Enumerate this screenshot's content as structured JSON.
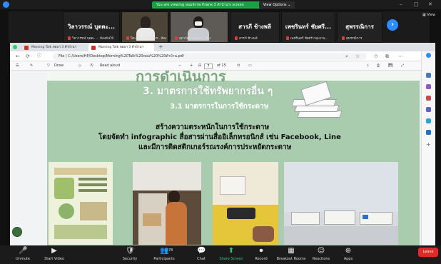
{
  "zoom": {
    "share_banner": "You are viewing หอมจักรพ Hrane 3 ตำบ้าน's screen",
    "view_options": "View Options ⌄",
    "view_label": "▦ View",
    "leave": "Leave"
  },
  "gallery": [
    {
      "name": "วิลาวรรณ์ บุตตะ...",
      "sub": "วิลาวรรณ์ บุตตะ ... ห้องต้นไม้"
    },
    {
      "name": "",
      "sub": "ปิยะวรร.นาวาสจิตร...ห้อง"
    },
    {
      "name": "",
      "sub": "สุดารัตน์ ขันธ์จร...ห้อง"
    },
    {
      "name": "สารภี ช้างพลี",
      "sub": "สารภี ช้างพลี"
    },
    {
      "name": "เพชรินทร์ ชัยศรี...",
      "sub": "เพชรินทร์ ชัยศรี กลุ่มงาน..."
    },
    {
      "name": "สุพรรณิการ",
      "sub": "สุพรรณิการ"
    }
  ],
  "browser": {
    "tabs": [
      "Morning Talk หอมฯ 3 ตำบ้านฯ",
      "Morning Talk หอมฯ 3 ตำบ้านฯ"
    ],
    "address": "File | C:/Users/HP/Desktop/Morning%20Talk%20หอม%20%20ตำบ้าน.pdf",
    "pdf_draw": "Draw",
    "pdf_read": "Read aloud",
    "pdf_page": "7",
    "pdf_of": "of 15"
  },
  "slide": {
    "top_title": "การดำเนินการ",
    "h1": "3. มาตรการใช้ทรัพยากรอื่น ๆ",
    "h2": "3.1 มาตรการในการใช้กระดาษ",
    "line1": "สร้างความตระหนักในการใช้กระดาษ",
    "line2": "โดยจัดทำ infographic สื่อสารผ่านสื่ออิเล็กทรอนิกส์ เช่น Facebook, Line",
    "line3": "และมีการติดสติกเกอร์รณรงค์การประหยัดกระดาษ"
  },
  "toolbar": [
    {
      "label": "Unmute",
      "icon": "🎤"
    },
    {
      "label": "Start Video",
      "icon": "▶"
    },
    {
      "label": "Security",
      "icon": "🛡"
    },
    {
      "label": "Participants",
      "icon": "👥",
      "count": "78"
    },
    {
      "label": "Chat",
      "icon": "💬"
    },
    {
      "label": "Share Screen",
      "icon": "⬆"
    },
    {
      "label": "Record",
      "icon": "⏺"
    },
    {
      "label": "Breakout Rooms",
      "icon": "▦"
    },
    {
      "label": "Reactions",
      "icon": "☺"
    },
    {
      "label": "Apps",
      "icon": "⊕"
    }
  ],
  "colors": {
    "share_green": "#1e9e45",
    "leave_red": "#e02828",
    "slide_green": "#a9ccae"
  }
}
